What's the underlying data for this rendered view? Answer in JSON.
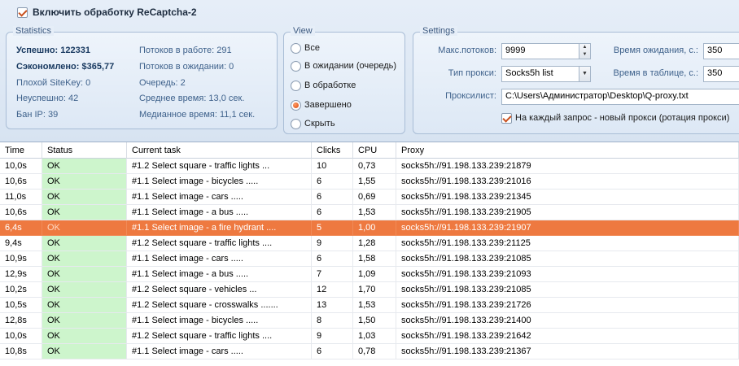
{
  "top": {
    "enable_label": "Включить обработку ReCaptcha-2"
  },
  "statistics": {
    "title": "Statistics",
    "success": "Успешно: 122331",
    "saved": "Сэкономлено: $365,77",
    "bad_sitekey": "Плохой SiteKey: 0",
    "failed": "Неуспешно: 42",
    "ban_ip": "Бан IP: 39",
    "threads_working": "Потоков в работе: 291",
    "threads_waiting": "Потоков в ожидании: 0",
    "queue": "Очередь: 2",
    "avg_time": "Среднее время: 13,0 сек.",
    "median_time": "Медианное время: 11,1 сек."
  },
  "view": {
    "title": "View",
    "options": [
      "Все",
      "В ожидании (очередь)",
      "В обработке",
      "Завершено",
      "Скрыть"
    ],
    "selected": "Завершено"
  },
  "settings": {
    "title": "Settings",
    "max_threads_label": "Макс.потоков:",
    "max_threads_value": "9999",
    "proxy_type_label": "Тип прокси:",
    "proxy_type_value": "Socks5h list",
    "proxylist_label": "Проксилист:",
    "proxylist_value": "C:\\Users\\Администратор\\Desktop\\Q-proxy.txt",
    "wait_time_label": "Время ожидания, с.:",
    "wait_time_value": "350",
    "table_time_label": "Время в таблице, с.:",
    "table_time_value": "350",
    "rotation_label": "На каждый запрос - новый прокси (ротация прокси)"
  },
  "table": {
    "columns": [
      "Time",
      "Status",
      "Current task",
      "Clicks",
      "CPU",
      "Proxy"
    ],
    "rows": [
      [
        "10,0s",
        "OK",
        "#1.2 Select square - traffic lights ...",
        "10",
        "0,73",
        "socks5h://91.198.133.239:21879"
      ],
      [
        "10,6s",
        "OK",
        "#1.1 Select image - bicycles .....",
        "6",
        "1,55",
        "socks5h://91.198.133.239:21016"
      ],
      [
        "11,0s",
        "OK",
        "#1.1 Select image - cars .....",
        "6",
        "0,69",
        "socks5h://91.198.133.239:21345"
      ],
      [
        "10,6s",
        "OK",
        "#1.1 Select image - a bus .....",
        "6",
        "1,53",
        "socks5h://91.198.133.239:21905"
      ],
      [
        "6,4s",
        "OK",
        "#1.1 Select image - a fire hydrant ....",
        "5",
        "1,00",
        "socks5h://91.198.133.239:21907"
      ],
      [
        "9,4s",
        "OK",
        "#1.2 Select square - traffic lights ....",
        "9",
        "1,28",
        "socks5h://91.198.133.239:21125"
      ],
      [
        "10,9s",
        "OK",
        "#1.1 Select image - cars .....",
        "6",
        "1,58",
        "socks5h://91.198.133.239:21085"
      ],
      [
        "12,9s",
        "OK",
        "#1.1 Select image - a bus .....",
        "7",
        "1,09",
        "socks5h://91.198.133.239:21093"
      ],
      [
        "10,2s",
        "OK",
        "#1.2 Select square - vehicles ...",
        "12",
        "1,70",
        "socks5h://91.198.133.239:21085"
      ],
      [
        "10,5s",
        "OK",
        "#1.2 Select square - crosswalks .......",
        "13",
        "1,53",
        "socks5h://91.198.133.239:21726"
      ],
      [
        "12,8s",
        "OK",
        "#1.1 Select image - bicycles .....",
        "8",
        "1,50",
        "socks5h://91.198.133.239:21400"
      ],
      [
        "10,0s",
        "OK",
        "#1.2 Select square - traffic lights ....",
        "9",
        "1,03",
        "socks5h://91.198.133.239:21642"
      ],
      [
        "10,8s",
        "OK",
        "#1.1 Select image - cars .....",
        "6",
        "0,78",
        "socks5h://91.198.133.239:21367"
      ]
    ],
    "selected_row": 4
  },
  "colors": {
    "selected_row": "#ee7940",
    "status_ok": "#cdf5cc"
  }
}
